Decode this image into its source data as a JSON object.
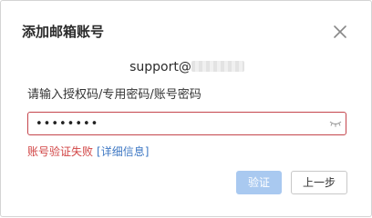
{
  "dialog": {
    "title": "添加邮箱账号",
    "close_icon": "close-icon"
  },
  "account": {
    "email_prefix": "support@"
  },
  "password": {
    "prompt": "请输入授权码/专用密码/账号密码",
    "value": "••••••••",
    "toggle_icon": "eye-closed-icon"
  },
  "error": {
    "message": "账号验证失败",
    "detail_link": "[详细信息]"
  },
  "buttons": {
    "verify": "验证",
    "previous": "上一步"
  },
  "colors": {
    "error_border": "#c4454c",
    "error_text": "#d14444",
    "link": "#3f78c4",
    "primary_disabled": "#a9c9f0"
  }
}
